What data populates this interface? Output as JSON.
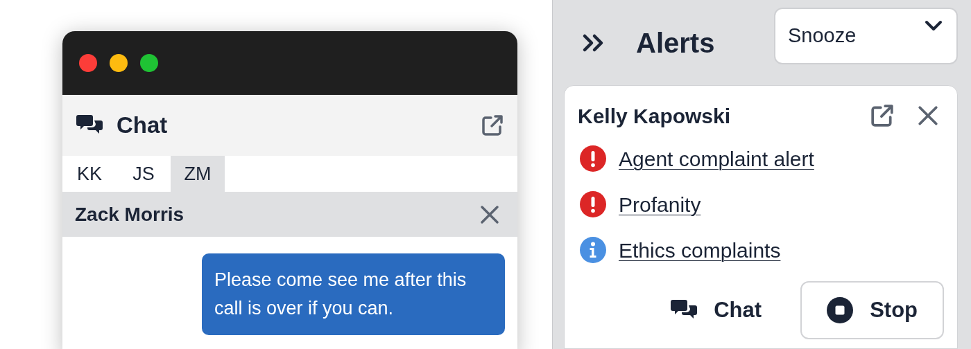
{
  "chat_window": {
    "title": "Chat",
    "tabs": [
      {
        "label": "KK",
        "selected": false
      },
      {
        "label": "JS",
        "selected": false
      },
      {
        "label": "ZM",
        "selected": true
      }
    ],
    "contact": "Zack Morris",
    "messages": [
      "Please come see me after this call is over if you can."
    ]
  },
  "alerts_panel": {
    "title": "Alerts",
    "snooze": {
      "value": "Snooze"
    },
    "card": {
      "name": "Kelly Kapowski",
      "alerts": [
        {
          "kind": "error",
          "label": "Agent complaint alert"
        },
        {
          "kind": "error",
          "label": "Profanity"
        },
        {
          "kind": "info",
          "label": "Ethics complaints"
        }
      ],
      "buttons": [
        {
          "kind": "chat",
          "label": "Chat"
        },
        {
          "kind": "stop",
          "label": "Stop"
        }
      ]
    }
  }
}
